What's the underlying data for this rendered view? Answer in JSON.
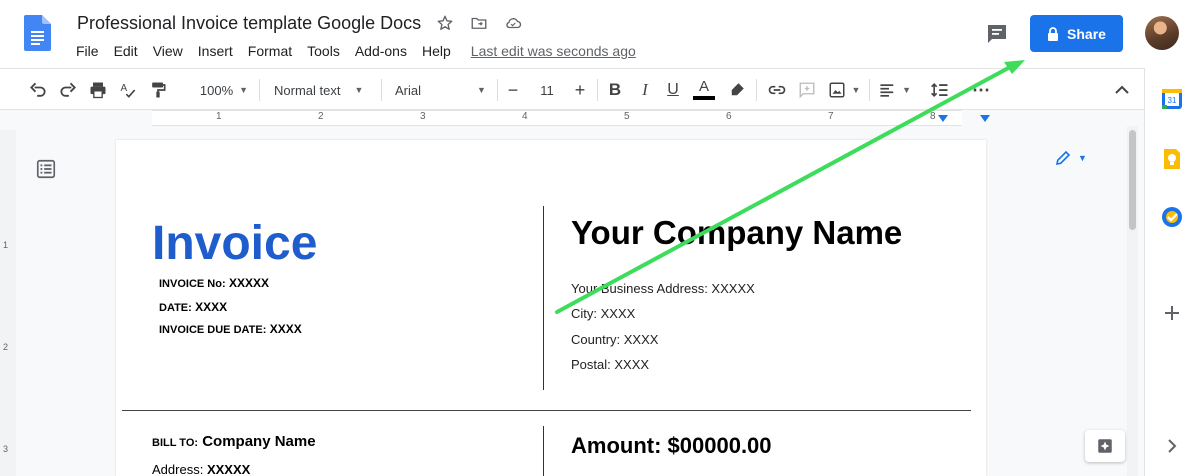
{
  "app": {
    "doc_title": "Professional Invoice template Google Docs",
    "last_edit": "Last edit was seconds ago",
    "share_label": "Share",
    "brand_color": "#1a73e8"
  },
  "menu": [
    "File",
    "Edit",
    "View",
    "Insert",
    "Format",
    "Tools",
    "Add-ons",
    "Help"
  ],
  "toolbar": {
    "zoom": "100%",
    "style": "Normal text",
    "font": "Arial",
    "font_size": "11",
    "icons": [
      "undo-icon",
      "redo-icon",
      "print-icon",
      "spellcheck-icon",
      "paint-format-icon",
      "bold-icon",
      "italic-icon",
      "underline-icon",
      "text-color-icon",
      "highlight-icon",
      "link-icon",
      "comment-icon",
      "image-icon",
      "align-icon",
      "line-spacing-icon",
      "more-icon",
      "pencil-icon",
      "collapse-icon"
    ]
  },
  "ruler": {
    "numbers": [
      "1",
      "2",
      "3",
      "4",
      "5",
      "6",
      "7",
      "8"
    ]
  },
  "vruler": {
    "numbers": [
      "1",
      "2",
      "3"
    ]
  },
  "document": {
    "invoice_title": "Invoice",
    "invoice_no_label": "INVOICE No:",
    "invoice_no_value": "XXXXX",
    "date_label": "DATE:",
    "date_value": "XXXX",
    "due_label": "INVOICE DUE DATE:",
    "due_value": "XXXX",
    "company_name": "Your Company Name",
    "business_address": "Your Business Address: XXXXX",
    "city": "City: XXXX",
    "country": "Country: XXXX",
    "postal": "Postal: XXXX",
    "bill_to_label": "BILL TO:",
    "bill_to_value": "Company Name",
    "address_label": "Address:",
    "address_value": "XXXXX",
    "amount": "Amount: $00000.00",
    "title_color": "#1f5ccc"
  },
  "annotation": {
    "arrow_color": "#3ddc5a"
  }
}
